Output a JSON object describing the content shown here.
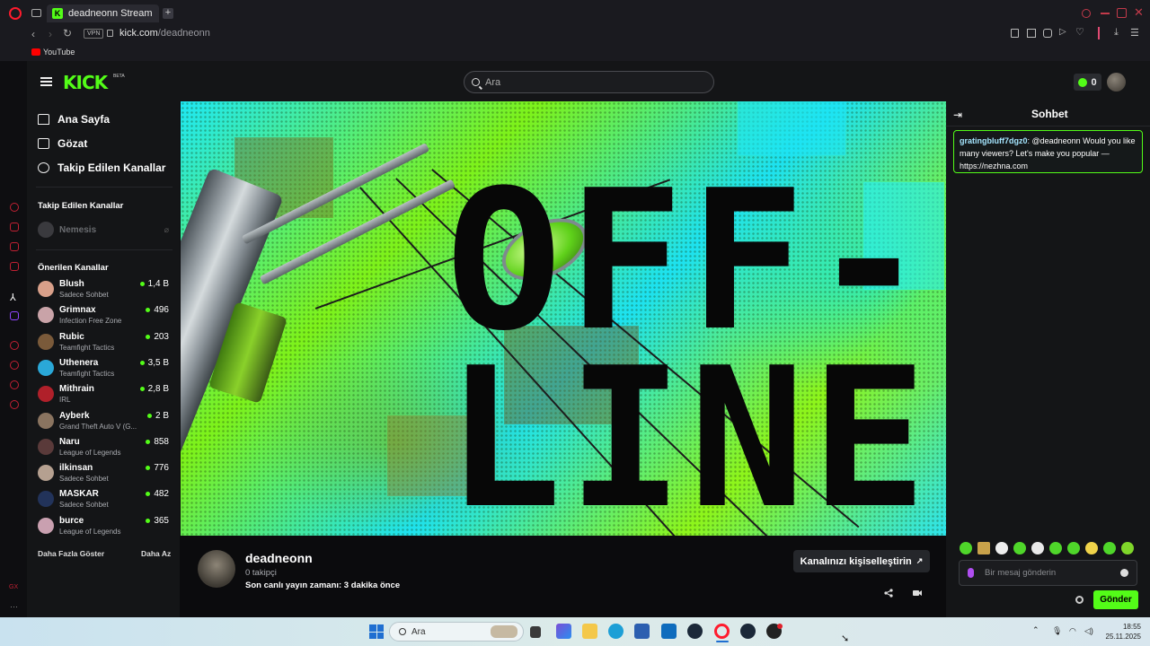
{
  "browser": {
    "tab_title": "deadneonn Stream - Watc",
    "tab_favicon": "K",
    "new_tab": "+",
    "vpn": "VPN",
    "url_domain": "kick.com",
    "url_path": "/deadneonn",
    "bookmark": "YouTube"
  },
  "header": {
    "logo": "KICK",
    "beta": "BETA",
    "search_placeholder": "Ara",
    "kicks_count": "0",
    "accent": "#53fc18"
  },
  "nav": {
    "home": "Ana Sayfa",
    "browse": "Gözat",
    "following": "Takip Edilen Kanallar"
  },
  "followed": {
    "title": "Takip Edilen Kanallar",
    "items": [
      {
        "name": "Nemesis"
      }
    ]
  },
  "recommended": {
    "title": "Önerilen Kanallar",
    "items": [
      {
        "name": "Blush",
        "category": "Sadece Sohbet",
        "viewers": "1,4 B"
      },
      {
        "name": "Grimnax",
        "category": "Infection Free Zone",
        "viewers": "496"
      },
      {
        "name": "Rubic",
        "category": "Teamfight Tactics",
        "viewers": "203"
      },
      {
        "name": "Uthenera",
        "category": "Teamfight Tactics",
        "viewers": "3,5 B"
      },
      {
        "name": "Mithrain",
        "category": "IRL",
        "viewers": "2,8 B"
      },
      {
        "name": "Ayberk",
        "category": "Grand Theft Auto V (G...",
        "viewers": "2 B"
      },
      {
        "name": "Naru",
        "category": "League of Legends",
        "viewers": "858"
      },
      {
        "name": "ilkinsan",
        "category": "Sadece Sohbet",
        "viewers": "776"
      },
      {
        "name": "MASKAR",
        "category": "Sadece Sohbet",
        "viewers": "482"
      },
      {
        "name": "burce",
        "category": "League of Legends",
        "viewers": "365"
      }
    ],
    "show_more": "Daha Fazla Göster",
    "show_less": "Daha Az"
  },
  "player": {
    "offline_line1": "OFF-",
    "offline_line2": "LINE"
  },
  "channel": {
    "name": "deadneonn",
    "followers": "0 takipçi",
    "last_live": "Son canlı yayın zamanı: 3 dakika önce",
    "customize": "Kanalınızı kişiselleştirin"
  },
  "chat": {
    "title": "Sohbet",
    "message": {
      "user": "gratingbluff7dgz0",
      "text": ": @deadneonn Would you like many viewers? Let's make you popular — https://nezhna.com"
    },
    "input_placeholder": "Bir mesaj gönderin",
    "send": "Gönder"
  },
  "taskbar": {
    "search": "Ara",
    "time": "18:55",
    "date": "25.11.2025"
  }
}
